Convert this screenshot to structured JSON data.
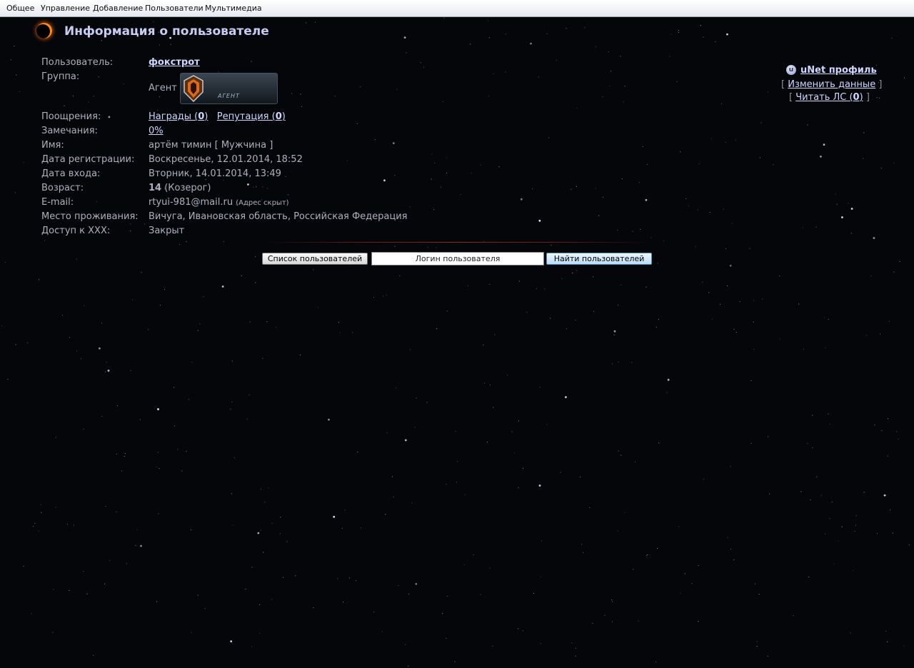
{
  "menubar": {
    "items": [
      "Общее",
      "Управление",
      "Добавление",
      "Пользователи",
      "Мультимедиа"
    ]
  },
  "page": {
    "title": "Информация о пользователе"
  },
  "profile": {
    "user_label": "Пользователь:",
    "username": "фокстрот",
    "group_label": "Группа:",
    "group_name": "Агент",
    "group_badge_text": "АГЕНТ",
    "rewards_label": "Поощрения:",
    "awards_text": "Награды (",
    "awards_count": "0",
    "reputation_text": "Репутация (",
    "reputation_count": "0",
    "close_paren": ")",
    "warnings_label": "Замечания:",
    "warnings_value": "0%",
    "name_label": "Имя:",
    "name_value": "артём тимин [ Мужчина ]",
    "reg_label": "Дата регистрации:",
    "reg_value": "Воскресенье, 12.01.2014, 18:52",
    "login_label": "Дата входа:",
    "login_value": "Вторник, 14.01.2014, 13:49",
    "age_label": "Возраст:",
    "age_number": "14",
    "age_sign": "(Козерог)",
    "email_label": "E-mail:",
    "email_value": "rtyui-981@mail.ru",
    "email_note": "(Адрес скрыт)",
    "residence_label": "Место проживания:",
    "residence_value": "Вичуга, Ивановская область, Российская Федерация",
    "xxx_label": "Доступ к XXX:",
    "xxx_value": "Закрыт"
  },
  "sidebar": {
    "unet_icon_letter": "u",
    "unet_profile": "uNet профиль",
    "bracket_open": "[",
    "bracket_close": "]",
    "edit_data": "Изменить данные",
    "read_pm": "Читать ЛС (",
    "pm_count": "0",
    "close_paren": ")"
  },
  "search": {
    "user_list_button": "Список пользователей",
    "login_input_value": "Логин пользователя",
    "find_users_button": "Найти пользователей"
  },
  "colors": {
    "background": "#05060a",
    "label_text": "#aab1bd",
    "link": "#cfd6ff",
    "title": "#c7cdf2"
  }
}
